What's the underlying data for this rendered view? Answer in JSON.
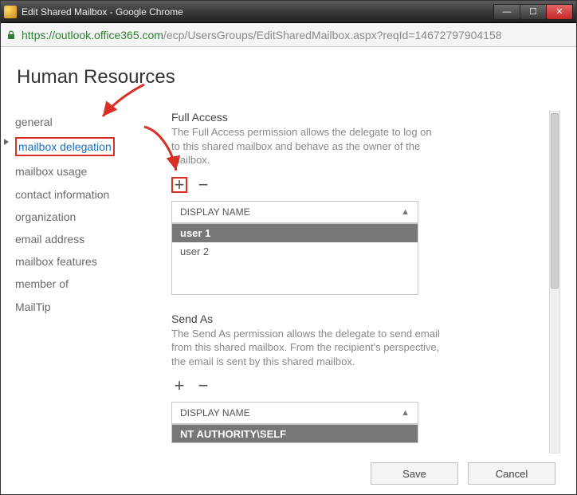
{
  "window": {
    "title": "Edit Shared Mailbox - Google Chrome"
  },
  "address": {
    "host": "https://outlook.office365.com",
    "path": "/ecp/UsersGroups/EditSharedMailbox.aspx?reqId=14672797904158"
  },
  "page": {
    "title": "Human Resources"
  },
  "sidebar": {
    "items": [
      {
        "label": "general"
      },
      {
        "label": "mailbox delegation",
        "selected": true
      },
      {
        "label": "mailbox usage"
      },
      {
        "label": "contact information"
      },
      {
        "label": "organization"
      },
      {
        "label": "email address"
      },
      {
        "label": "mailbox features"
      },
      {
        "label": "member of"
      },
      {
        "label": "MailTip"
      }
    ]
  },
  "fullAccess": {
    "title": "Full Access",
    "desc": "The Full Access permission allows the delegate to log on to this shared mailbox and behave as the owner of the mailbox.",
    "header": "DISPLAY NAME",
    "rows": [
      "user 1",
      "user 2"
    ]
  },
  "sendAs": {
    "title": "Send As",
    "desc": "The Send As permission allows the delegate to send email from this shared mailbox. From the recipient's perspective, the email is sent by this shared mailbox.",
    "header": "DISPLAY NAME",
    "rows": [
      "NT AUTHORITY\\SELF"
    ]
  },
  "buttons": {
    "save": "Save",
    "cancel": "Cancel"
  },
  "icons": {
    "plus": "+",
    "minus": "−",
    "sort": "▲"
  }
}
